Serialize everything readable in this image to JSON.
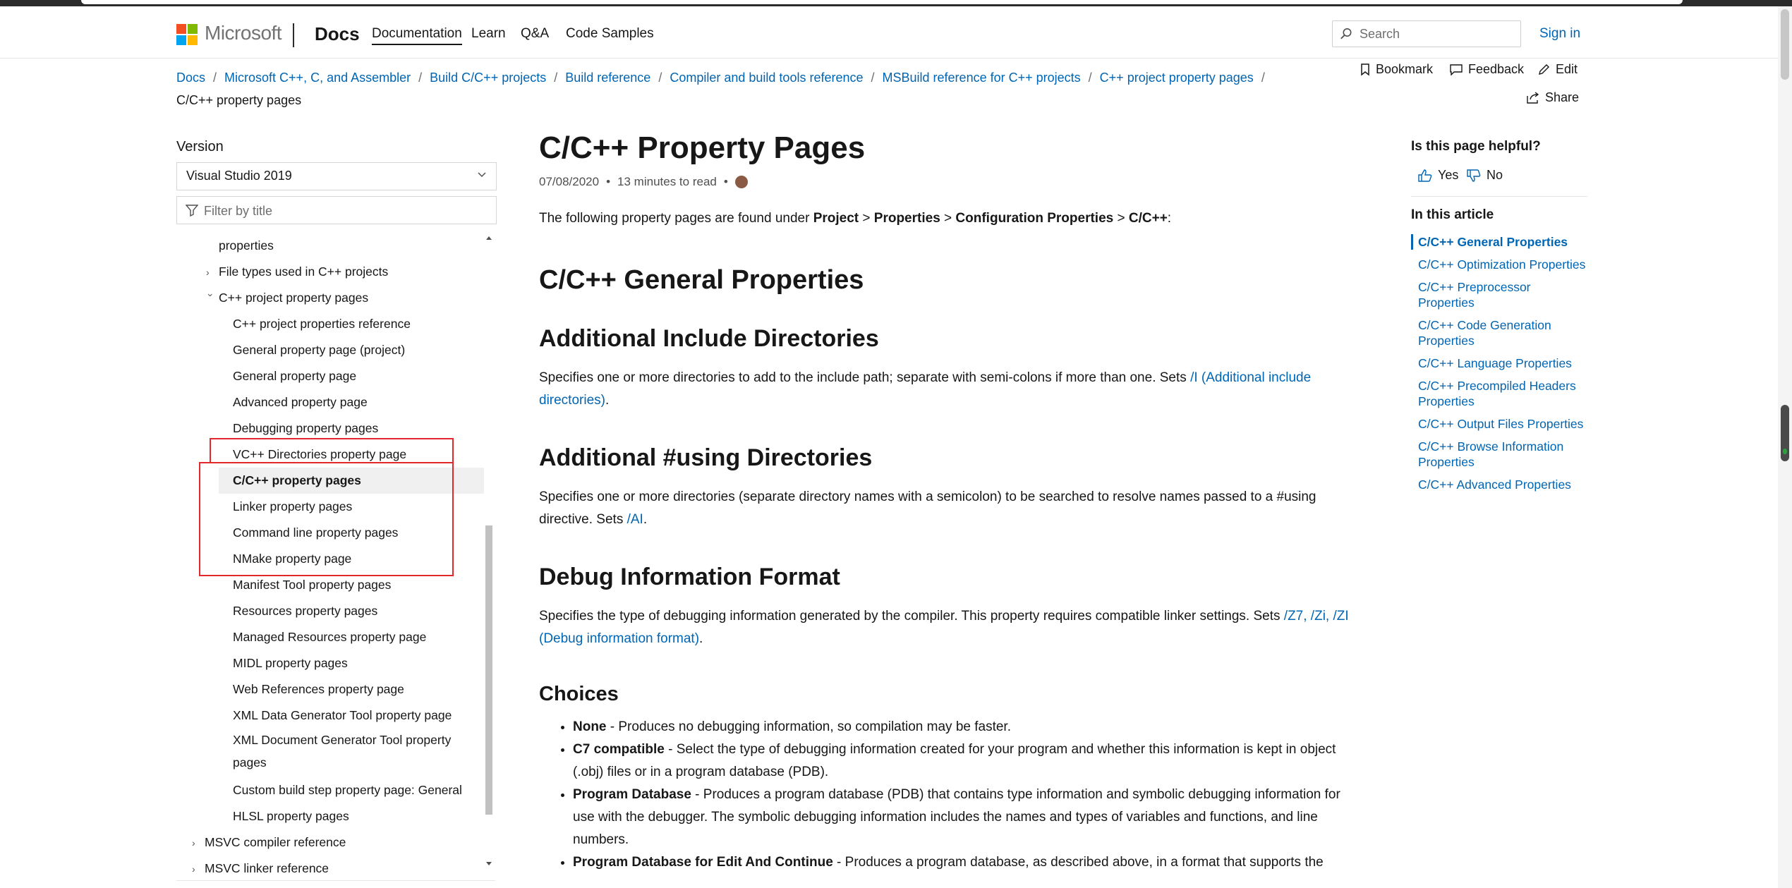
{
  "header": {
    "brand": "Microsoft",
    "site": "Docs",
    "nav": [
      "Documentation",
      "Learn",
      "Q&A",
      "Code Samples"
    ],
    "search_placeholder": "Search",
    "signin": "Sign in"
  },
  "breadcrumb": [
    "Docs",
    "Microsoft C++, C, and Assembler",
    "Build C/C++ projects",
    "Build reference",
    "Compiler and build tools reference",
    "MSBuild reference for C++ projects",
    "C++ project property pages",
    "C/C++ property pages"
  ],
  "actions": {
    "bookmark": "Bookmark",
    "feedback": "Feedback",
    "edit": "Edit",
    "share": "Share"
  },
  "sidebar": {
    "version_label": "Version",
    "version_value": "Visual Studio 2019",
    "filter_placeholder": "Filter by title",
    "items": [
      "properties",
      "File types used in C++ projects",
      "C++ project property pages",
      "C++ project properties reference",
      "General property page (project)",
      "General property page",
      "Advanced property page",
      "Debugging property pages",
      "VC++ Directories property page",
      "C/C++ property pages",
      "Linker property pages",
      "Command line property pages",
      "NMake property page",
      "Manifest Tool property pages",
      "Resources property pages",
      "Managed Resources property page",
      "MIDL property pages",
      "Web References property page",
      "XML Data Generator Tool property page",
      "XML Document Generator Tool property pages",
      "Custom build step property page: General",
      "HLSL property pages",
      "MSVC compiler reference",
      "MSVC linker reference"
    ]
  },
  "article": {
    "title": "C/C++ Property Pages",
    "date": "07/08/2020",
    "read_time": "13 minutes to read",
    "intro": {
      "prefix": "The following property pages are found under ",
      "b1": "Project",
      "s1": " > ",
      "b2": "Properties",
      "s2": " > ",
      "b3": "Configuration Properties",
      "s3": " > ",
      "b4": "C/C++",
      "suffix": ":"
    },
    "h_general": "C/C++ General Properties",
    "h_include": "Additional Include Directories",
    "include_text": "Specifies one or more directories to add to the include path; separate with semi-colons if more than one. Sets ",
    "include_link": "/I (Additional include directories)",
    "h_using": "Additional #using Directories",
    "using_text": "Specifies one or more directories (separate directory names with a semicolon) to be searched to resolve names passed to a #using directive. Sets ",
    "using_link": "/AI",
    "h_debug": "Debug Information Format",
    "debug_text": "Specifies the type of debugging information generated by the compiler. This property requires compatible linker settings. Sets ",
    "debug_link": "/Z7, /Zi, /ZI (Debug information format)",
    "h_choices": "Choices",
    "choices": [
      {
        "name": "None",
        "desc": " - Produces no debugging information, so compilation may be faster."
      },
      {
        "name": "C7 compatible",
        "desc": " - Select the type of debugging information created for your program and whether this information is kept in object (.obj) files or in a program database (PDB)."
      },
      {
        "name": "Program Database",
        "desc": " - Produces a program database (PDB) that contains type information and symbolic debugging information for use with the debugger. The symbolic debugging information includes the names and types of variables and functions, and line numbers."
      },
      {
        "name": "Program Database for Edit And Continue",
        "desc": " - Produces a program database, as described above, in a format that supports the"
      }
    ]
  },
  "rightrail": {
    "helpful": "Is this page helpful?",
    "yes": "Yes",
    "no": "No",
    "in_article": "In this article",
    "items": [
      "C/C++ General Properties",
      "C/C++ Optimization Properties",
      "C/C++ Preprocessor Properties",
      "C/C++ Code Generation Properties",
      "C/C++ Language Properties",
      "C/C++ Precompiled Headers Properties",
      "C/C++ Output Files Properties",
      "C/C++ Browse Information Properties",
      "C/C++ Advanced Properties"
    ]
  },
  "colors": {
    "link": "#0065b3",
    "annotation": "#e0282e",
    "logo": [
      "#f25022",
      "#7fba00",
      "#00a4ef",
      "#ffb900"
    ]
  }
}
